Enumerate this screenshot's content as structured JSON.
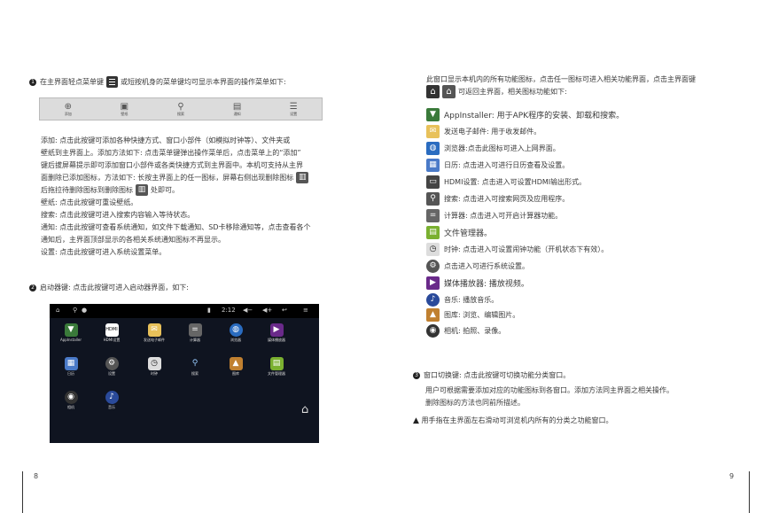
{
  "left": {
    "item1_pre": "在主界面轻点菜单键",
    "item1_post": "或短按机身的菜单键均可显示本界面的操作菜单如下:",
    "menu_items": [
      "添加",
      "壁纸",
      "搜索",
      "通知",
      "设置"
    ],
    "desc_lines": [
      "添加:  点击此按键可添加各种快捷方式、窗口小部件（如模拟时钟等）、文件夹或",
      "壁纸到主界面上。添加方法如下:  点击菜单键弹出操作菜单后，点击菜单上的“添加”",
      "键后拔屏幕提示即可添加窗口小部件或各类快捷方式到主界面中。本机可支持从主界",
      "面删除已添加图标，方法如下: 长按主界面上的任一图标，屏幕右侧出现删除图标",
      "后拖拉待删除图标到删除图标",
      "壁纸:  点击此按键可重设壁纸。",
      "搜索:  点击此按键可进入搜索内容输入等待状态。",
      "通知:  点击此按键可查看系统通知，如文件下载通知、SD卡移除通知等，点击查看各个",
      "通知后，主界面顶部显示的各相关系统通知图标不再显示。",
      "设置:  点击此按键可进入系统设置菜单。"
    ],
    "desc_line5_post": "处即可。",
    "item2": "启动器键:  点击此按键可进入启动器界面，如下:",
    "launcher": {
      "time": "2:12",
      "apps": [
        "AppInstaller",
        "HDMI设置",
        "发送电子邮件",
        "计算器",
        "浏览器",
        "媒体播放器",
        "日历",
        "设置",
        "时钟",
        "搜索",
        "图库",
        "文件管理器",
        "相机",
        "音乐"
      ]
    },
    "page_number": "8"
  },
  "right": {
    "intro1": "此窗口显示本机内的所有功能图标，点击任一图标可进入相关功能界面，点击主界面键",
    "intro2": "可返回主界面，相关图标功能如下:",
    "items": [
      "AppInstaller:  用于APK程序的安装、卸载和搜索。",
      "发送电子邮件:  用于收发邮件。",
      "浏览器:点击此图标可进入上网界面。",
      "日历:  点击进入可进行日历查看及设置。",
      "HDMI设置:  点击进入可设置HDMI输出形式。",
      "搜索:  点击进入可搜索网页及应用程序。",
      "计算器:  点击进入可开启计算器功能。",
      "文件管理器。",
      "时钟:  点击进入可设置闹钟功能（开机状态下有效）。",
      "点击进入可进行系统设置。",
      "媒体播放器:  播放视频。",
      "音乐:  播放音乐。",
      "图库:  浏览、编辑图片。",
      "相机:  拍照、录像。"
    ],
    "window_switch_title": "窗口切换键:  点击此按键可切换功能分类窗口。",
    "window_switch_line2": "用户可根据需要添加对应的功能图标到各窗口。添加方法同主界面之相关操作。",
    "window_switch_line3": "删除图标的方法也同前所描述。",
    "tip": "用手指在主界面左右滑动可浏览机内所有的分类之功能窗口。",
    "page_number": "9"
  }
}
